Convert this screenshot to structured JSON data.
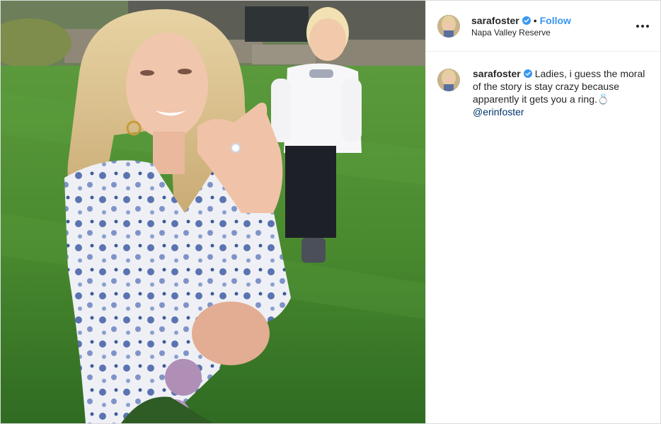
{
  "post": {
    "username": "sarafoster",
    "separator": "•",
    "follow_label": "Follow",
    "location": "Napa Valley Reserve"
  },
  "caption": {
    "username": "sarafoster",
    "text": "Ladies, i guess the moral of the story is stay crazy because apparently it gets you a ring.💍",
    "mention": "@erinfoster"
  },
  "colors": {
    "link_blue": "#3897f0",
    "mention_blue": "#003569",
    "verified_blue": "#3897f0",
    "text": "#262626",
    "border": "#dbdbdb"
  },
  "icons": {
    "verified": "verified-badge-icon",
    "more": "more-options-icon"
  }
}
